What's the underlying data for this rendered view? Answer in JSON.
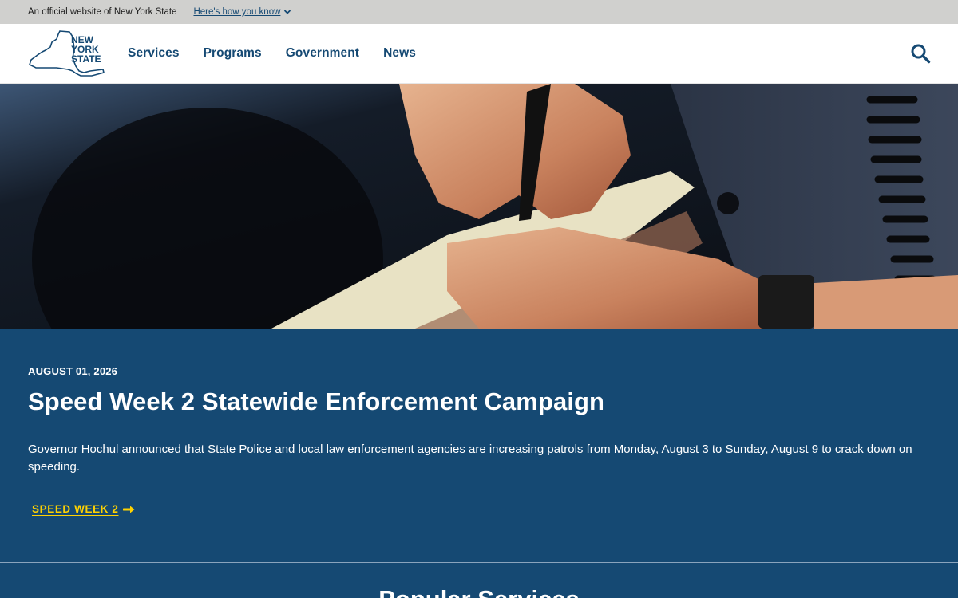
{
  "banner": {
    "official_text": "An official website of New York State",
    "know_link": "Here's how you know"
  },
  "header": {
    "logo_text": [
      "NEW",
      "YORK",
      "STATE"
    ],
    "nav": [
      {
        "label": "Services"
      },
      {
        "label": "Programs"
      },
      {
        "label": "Government"
      },
      {
        "label": "News"
      }
    ],
    "search_icon": "search-icon"
  },
  "feature": {
    "date": "AUGUST 01, 2026",
    "title": "Speed Week 2 Statewide Enforcement Campaign",
    "body": "Governor Hochul announced that State Police and local law enforcement agencies are increasing patrols from Monday, August 3 to Sunday, August 9 to crack down on speeding.",
    "cta_label": "SPEED WEEK 2",
    "cta_icon": "arrow-right-icon"
  },
  "popular": {
    "heading": "Popular Services"
  },
  "colors": {
    "brand_blue": "#154973",
    "accent_yellow": "#ffd200",
    "banner_gray": "#d0d0ce"
  }
}
